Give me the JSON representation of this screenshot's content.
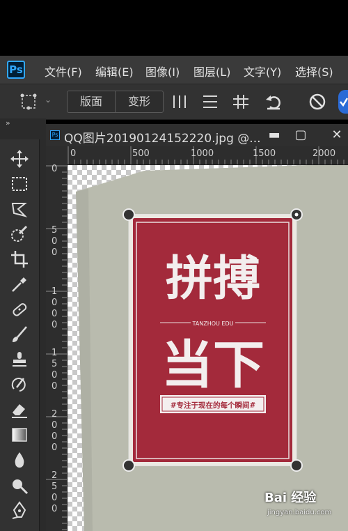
{
  "app": {
    "logo": "Ps"
  },
  "menu": [
    {
      "label": "文件(F)"
    },
    {
      "label": "编辑(E)"
    },
    {
      "label": "图像(I)"
    },
    {
      "label": "图层(L)"
    },
    {
      "label": "文字(Y)"
    },
    {
      "label": "选择(S)"
    }
  ],
  "options": {
    "btn_layout": "版面",
    "btn_transform": "变形"
  },
  "document": {
    "title": "QQ图片20190124152220.jpg @..."
  },
  "ruler": {
    "top_labels": [
      "0",
      "500",
      "1000",
      "1500",
      "2000"
    ],
    "left_labels": [
      "0",
      "500",
      "1000",
      "1500",
      "2000",
      "2500"
    ]
  },
  "poster": {
    "headline_1": "拼搏",
    "subtitle": "TANZHOU EDU",
    "headline_2": "当下",
    "slogan": "#专注于现在的每个瞬间#",
    "color": "#a32a3b"
  },
  "watermark": {
    "brand": "Bai 经验",
    "url": "jingyan.baidu.com"
  },
  "colors": {
    "accent": "#31a8ff",
    "menubar": "#3a3a3a",
    "panel": "#323232"
  }
}
